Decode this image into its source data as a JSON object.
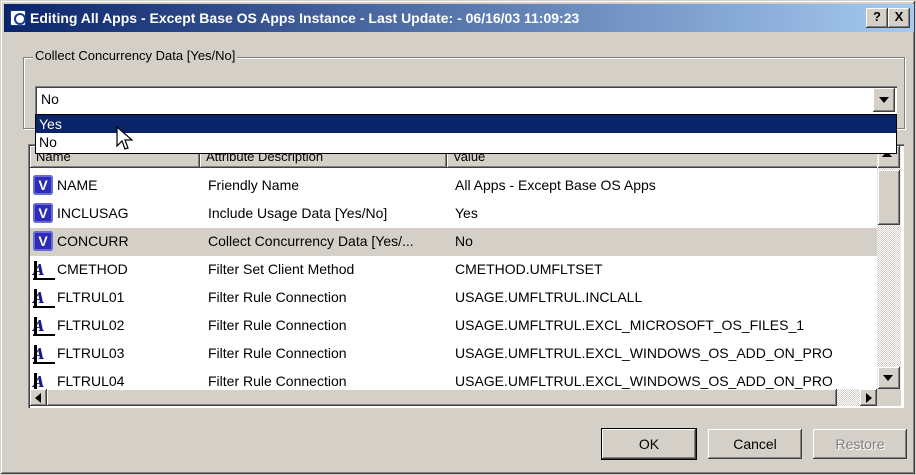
{
  "window": {
    "title": "Editing All Apps - Except Base OS Apps Instance - Last Update: - 06/16/03 11:09:23",
    "help_button": "?",
    "close_button": "X"
  },
  "group": {
    "legend": "Collect Concurrency Data [Yes/No]",
    "selected_value": "No",
    "options": [
      "Yes",
      "No"
    ],
    "highlighted_option": "Yes"
  },
  "table": {
    "columns": [
      "Name",
      "Attribute Description",
      "Value"
    ],
    "rows": [
      {
        "icon": "variable-icon",
        "name": "NAME",
        "description": "Friendly Name",
        "value": "All Apps - Except Base OS Apps"
      },
      {
        "icon": "variable-icon",
        "name": "INCLUSAG",
        "description": "Include Usage Data [Yes/No]",
        "value": "Yes"
      },
      {
        "icon": "variable-icon",
        "name": "CONCURR",
        "description": "Collect Concurrency Data [Yes/...",
        "value": "No"
      },
      {
        "icon": "connection-icon",
        "name": "CMETHOD",
        "description": "Filter Set Client Method",
        "value": "CMETHOD.UMFLTSET"
      },
      {
        "icon": "connection-icon",
        "name": "FLTRUL01",
        "description": "Filter Rule Connection",
        "value": "USAGE.UMFLTRUL.INCLALL"
      },
      {
        "icon": "connection-icon",
        "name": "FLTRUL02",
        "description": "Filter Rule Connection",
        "value": "USAGE.UMFLTRUL.EXCL_MICROSOFT_OS_FILES_1"
      },
      {
        "icon": "connection-icon",
        "name": "FLTRUL03",
        "description": "Filter Rule Connection",
        "value": "USAGE.UMFLTRUL.EXCL_WINDOWS_OS_ADD_ON_PRO"
      },
      {
        "icon": "connection-icon",
        "name": "FLTRUL04",
        "description": "Filter Rule Connection",
        "value": "USAGE.UMFLTRUL.EXCL_WINDOWS_OS_ADD_ON_PRO"
      }
    ],
    "selected_row": 2,
    "variable_icon_glyph": "V",
    "connection_icon_glyph": "A"
  },
  "buttons": {
    "ok": "OK",
    "cancel": "Cancel",
    "restore": "Restore"
  },
  "colors": {
    "title_gradient_start": "#0a246a",
    "title_gradient_end": "#a6caf0",
    "selection_highlight": "#0a246a",
    "dialog_face": "#d4d0c8"
  }
}
